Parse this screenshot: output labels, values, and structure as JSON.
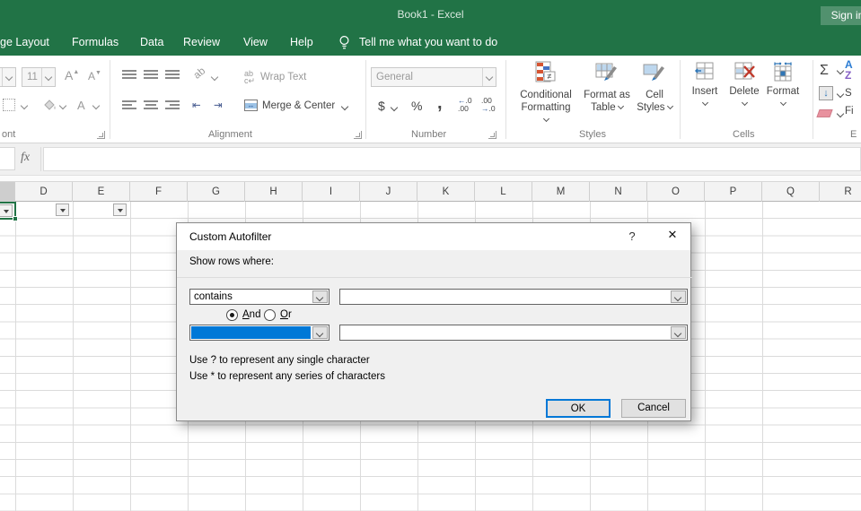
{
  "titlebar": {
    "title": "Book1  -  Excel",
    "sign_in": "Sign in"
  },
  "ribbon_tabs": [
    "ge Layout",
    "Formulas",
    "Data",
    "Review",
    "View",
    "Help"
  ],
  "tell_me": "Tell me what you want to do",
  "ribbon": {
    "font": {
      "size_value": "11",
      "grow_font": "A",
      "shrink_font": "A",
      "font_color": "A",
      "group_label": "ont"
    },
    "alignment": {
      "orientation": "ab",
      "wrap_text": "Wrap Text",
      "merge_center": "Merge & Center",
      "group_label": "Alignment"
    },
    "number": {
      "format_value": "General",
      "dollar": "$",
      "percent": "%",
      "comma": ",",
      "inc_top": ".0",
      "inc_bottom": ".00",
      "dec_top": ".00",
      "dec_bottom": ".0",
      "group_label": "Number"
    },
    "styles": {
      "buttons": [
        {
          "line1": "Conditional",
          "line2": "Formatting"
        },
        {
          "line1": "Format as",
          "line2": "Table"
        },
        {
          "line1": "Cell",
          "line2": "Styles"
        }
      ],
      "group_label": "Styles"
    },
    "cells": {
      "buttons": [
        "Insert",
        "Delete",
        "Format"
      ],
      "group_label": "Cells"
    },
    "editing": {
      "autosum": "Σ",
      "sort_a": "A",
      "sort_z": "Z",
      "partial_sort": "S",
      "partial_find": "Fi",
      "group_label": "E"
    }
  },
  "formula_bar": {
    "fx": "fx"
  },
  "columns": [
    "D",
    "E",
    "F",
    "G",
    "H",
    "I",
    "J",
    "K",
    "L",
    "M",
    "N",
    "O",
    "P",
    "Q",
    "R"
  ],
  "dialog": {
    "title": "Custom Autofilter",
    "help_button": "?",
    "close_button": "✕",
    "show_rows_label": "Show rows where:",
    "operator1_value": "contains",
    "operator2_value": "",
    "value1": "",
    "value2": "",
    "and_first": "A",
    "and_rest": "nd",
    "or_first": "O",
    "or_rest": "r",
    "hint1": "Use ? to represent any single character",
    "hint2": "Use * to represent any series of characters",
    "ok_label": "OK",
    "cancel_label": "Cancel"
  },
  "colors": {
    "excel_green": "#217346",
    "selection_blue": "#0078d7"
  }
}
